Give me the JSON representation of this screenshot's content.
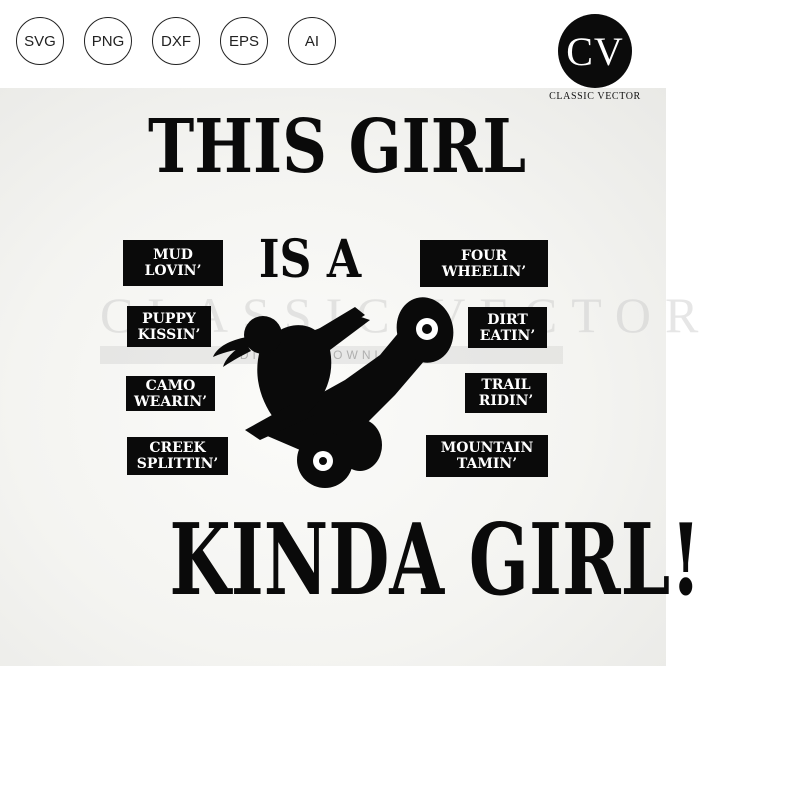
{
  "formats": [
    "SVG",
    "PNG",
    "DXF",
    "EPS",
    "AI"
  ],
  "logo": {
    "monogram": "CV",
    "name": "CLASSIC VECTOR"
  },
  "design": {
    "line1": "THIS GIRL",
    "line2": "IS A",
    "line3": "KINDA GIRL!",
    "tags_left": [
      "MUD\nLOVIN’",
      "PUPPY\nKISSIN’",
      "CAMO\nWEARIN’",
      "CREEK\nSPLITTIN’"
    ],
    "tags_right": [
      "FOUR\nWHEELIN’",
      "DIRT\nEATIN’",
      "TRAIL\nRIDIN’",
      "MOUNTAIN\nTAMIN’"
    ]
  },
  "watermark": {
    "main": "CLASSIC VECTOR",
    "band": "DIGITAL DOWNLOAD"
  },
  "colors": {
    "ink": "#0a0a0a",
    "background": "#ffffff"
  }
}
